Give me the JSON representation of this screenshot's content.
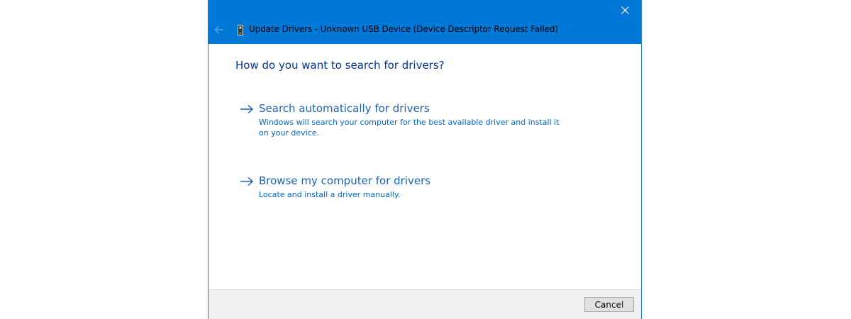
{
  "window": {
    "title": "Update Drivers - Unknown USB Device (Device Descriptor Request Failed)",
    "title_bar_color": "#0078d7",
    "icons": {
      "back": "back-arrow-icon",
      "device": "usb-device-icon",
      "close": "close-icon"
    }
  },
  "main": {
    "heading": "How do you want to search for drivers?",
    "options": [
      {
        "title": "Search automatically for drivers",
        "description": "Windows will search your computer for the best available driver and install it on your device."
      },
      {
        "title": "Browse my computer for drivers",
        "description": "Locate and install a driver manually."
      }
    ],
    "link_color": "#1e63b4"
  },
  "footer": {
    "cancel_label": "Cancel"
  }
}
